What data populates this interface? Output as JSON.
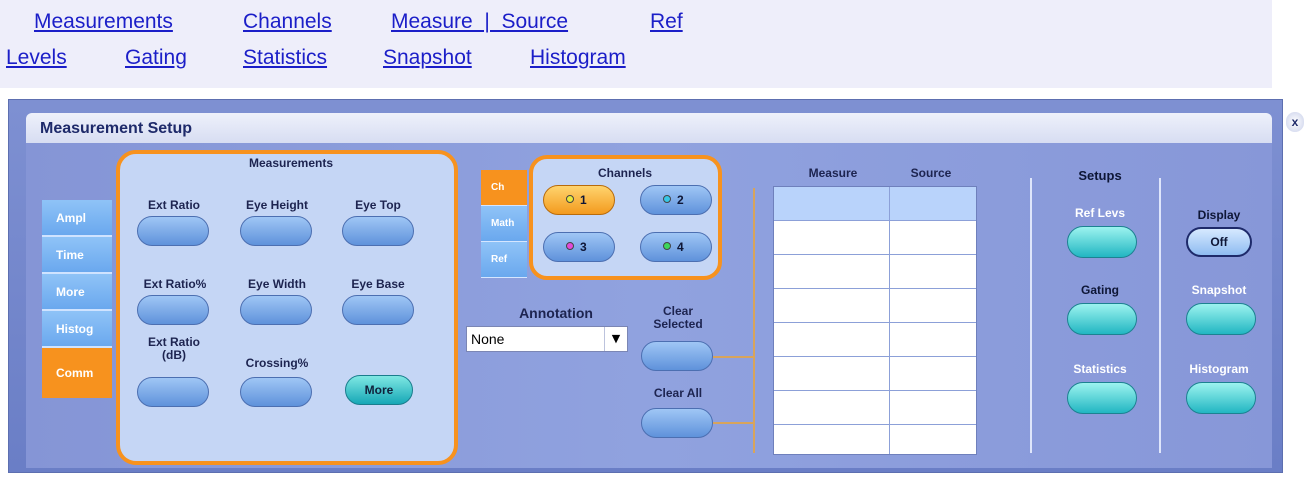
{
  "help_links": {
    "measurements": "Measurements",
    "channels": "Channels",
    "measure_source": "Measure  |  Source",
    "ref": "Ref",
    "levels": "Levels",
    "gating": "Gating",
    "statistics": "Statistics",
    "snapshot": "Snapshot",
    "histogram": "Histogram"
  },
  "window": {
    "title": "Measurement Setup",
    "close_glyph": "x"
  },
  "tabs": [
    {
      "label": "Ampl",
      "active": false
    },
    {
      "label": "Time",
      "active": false
    },
    {
      "label": "More",
      "active": false
    },
    {
      "label": "Histog",
      "active": false
    },
    {
      "label": "Comm",
      "active": true
    }
  ],
  "measurements": {
    "header": "Measurements",
    "ext_ratio": "Ext Ratio",
    "eye_height": "Eye Height",
    "eye_top": "Eye Top",
    "ext_ratio_pct": "Ext Ratio%",
    "eye_width": "Eye Width",
    "eye_base": "Eye Base",
    "ext_ratio_db_1": "Ext Ratio",
    "ext_ratio_db_2": "(dB)",
    "crossing": "Crossing%",
    "more": "More"
  },
  "source_tabs": [
    {
      "label": "Ch",
      "active": true
    },
    {
      "label": "Math",
      "active": false
    },
    {
      "label": "Ref",
      "active": false
    }
  ],
  "channels": {
    "header": "Channels",
    "items": [
      {
        "label": "1",
        "selected": true,
        "color": "#e8e83a"
      },
      {
        "label": "2",
        "selected": false,
        "color": "#37c7e6"
      },
      {
        "label": "3",
        "selected": false,
        "color": "#e24ad8"
      },
      {
        "label": "4",
        "selected": false,
        "color": "#3dd65a"
      }
    ]
  },
  "annotation": {
    "label": "Annotation",
    "value": "None",
    "arrow": "▼"
  },
  "clear": {
    "selected_1": "Clear",
    "selected_2": "Selected",
    "all": "Clear All"
  },
  "table": {
    "col_measure": "Measure",
    "col_source": "Source"
  },
  "setups": {
    "header": "Setups",
    "ref_levs": "Ref Levs",
    "gating": "Gating",
    "statistics": "Statistics"
  },
  "display": {
    "label": "Display",
    "value": "Off",
    "snapshot": "Snapshot",
    "histogram": "Histogram"
  },
  "colors": {
    "accent_orange": "#f7921e",
    "window_blue": "#7e90d2",
    "teal": "#22b6c2"
  }
}
